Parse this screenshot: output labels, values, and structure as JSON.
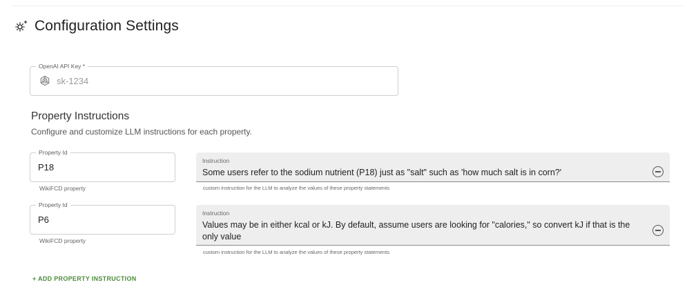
{
  "page": {
    "title": "Configuration Settings",
    "title_icon": "gear-sparkle-icon"
  },
  "api_key": {
    "label": "OpenAI API Key *",
    "icon": "openai-icon",
    "placeholder": "sk-1234",
    "value": ""
  },
  "property_section": {
    "title": "Property Instructions",
    "subtitle": "Configure and customize LLM instructions for each property."
  },
  "properties": [
    {
      "id_label": "Property Id",
      "id_value": "P18",
      "id_helper": "WikiFCD property",
      "instruction_label": "Instruction",
      "instruction_value": "Some users refer to the sodium nutrient (P18) just as \"salt\" such as 'how much salt is in corn?'",
      "instruction_helper": "custom instruction for the LLM to analyze the values of these property statements"
    },
    {
      "id_label": "Property Id",
      "id_value": "P6",
      "id_helper": "WikiFCD property",
      "instruction_label": "Instruction",
      "instruction_value": "Values may be in either kcal or kJ. By default, assume users are looking for \"calories,\" so convert kJ if that is the only value",
      "instruction_helper": "custom instruction for the LLM to analyze the values of these property statements"
    }
  ],
  "add_button": {
    "label": "+ ADD PROPERTY INSTRUCTION"
  },
  "colors": {
    "accent_green": "#4a8c3a",
    "filled_bg": "#eeeeee",
    "outline": "#cfcfcf"
  }
}
